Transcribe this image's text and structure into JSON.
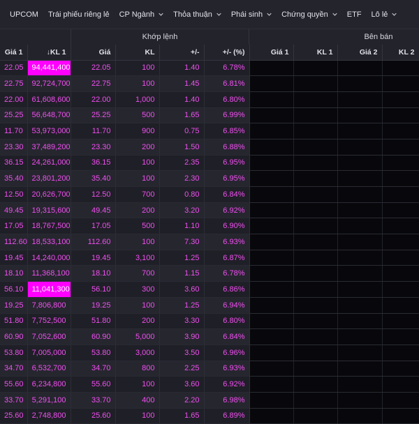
{
  "nav": [
    {
      "label": "UPCOM",
      "dropdown": false
    },
    {
      "label": "Trái phiếu riêng lẻ",
      "dropdown": false
    },
    {
      "label": "CP Ngành",
      "dropdown": true
    },
    {
      "label": "Thỏa thuận",
      "dropdown": true
    },
    {
      "label": "Phái sinh",
      "dropdown": true
    },
    {
      "label": "Chứng quyền",
      "dropdown": true
    },
    {
      "label": "ETF",
      "dropdown": false
    },
    {
      "label": "Lô lẻ",
      "dropdown": true
    }
  ],
  "groups": {
    "match": "Khớp lệnh",
    "sell": "Bên bán"
  },
  "columns": {
    "gia1": "Giá 1",
    "kl1_sort": "↓KL 1",
    "gia": "Giá",
    "kl": "KL",
    "change": "+/-",
    "pct": "+/- (%)",
    "sell_gia1": "Giá 1",
    "sell_kl1": "KL 1",
    "sell_gia2": "Giá 2",
    "sell_kl2": "KL 2"
  },
  "rows": [
    {
      "gia1": "22.05",
      "kl1": "94,441,400",
      "gia": "22.05",
      "kl": "100",
      "change": "1.40",
      "pct": "6.78%",
      "hl": true
    },
    {
      "gia1": "22.75",
      "kl1": "92,724,700",
      "gia": "22.75",
      "kl": "100",
      "change": "1.45",
      "pct": "6.81%"
    },
    {
      "gia1": "22.00",
      "kl1": "61,608,600",
      "gia": "22.00",
      "kl": "1,000",
      "change": "1.40",
      "pct": "6.80%"
    },
    {
      "gia1": "25.25",
      "kl1": "56,648,700",
      "gia": "25.25",
      "kl": "500",
      "change": "1.65",
      "pct": "6.99%"
    },
    {
      "gia1": "11.70",
      "kl1": "53,973,000",
      "gia": "11.70",
      "kl": "900",
      "change": "0.75",
      "pct": "6.85%"
    },
    {
      "gia1": "23.30",
      "kl1": "37,489,200",
      "gia": "23.30",
      "kl": "200",
      "change": "1.50",
      "pct": "6.88%"
    },
    {
      "gia1": "36.15",
      "kl1": "24,261,000",
      "gia": "36.15",
      "kl": "100",
      "change": "2.35",
      "pct": "6.95%"
    },
    {
      "gia1": "35.40",
      "kl1": "23,801,200",
      "gia": "35.40",
      "kl": "100",
      "change": "2.30",
      "pct": "6.95%"
    },
    {
      "gia1": "12.50",
      "kl1": "20,626,700",
      "gia": "12.50",
      "kl": "700",
      "change": "0.80",
      "pct": "6.84%"
    },
    {
      "gia1": "49.45",
      "kl1": "19,315,600",
      "gia": "49.45",
      "kl": "200",
      "change": "3.20",
      "pct": "6.92%"
    },
    {
      "gia1": "17.05",
      "kl1": "18,767,500",
      "gia": "17.05",
      "kl": "500",
      "change": "1.10",
      "pct": "6.90%"
    },
    {
      "gia1": "112.60",
      "kl1": "18,533,100",
      "gia": "112.60",
      "kl": "100",
      "change": "7.30",
      "pct": "6.93%"
    },
    {
      "gia1": "19.45",
      "kl1": "14,240,000",
      "gia": "19.45",
      "kl": "3,100",
      "change": "1.25",
      "pct": "6.87%"
    },
    {
      "gia1": "18.10",
      "kl1": "11,368,100",
      "gia": "18.10",
      "kl": "700",
      "change": "1.15",
      "pct": "6.78%"
    },
    {
      "gia1": "56.10",
      "kl1": "11,041,300",
      "gia": "56.10",
      "kl": "300",
      "change": "3.60",
      "pct": "6.86%",
      "hl": true
    },
    {
      "gia1": "19.25",
      "kl1": "7,806,800",
      "gia": "19.25",
      "kl": "100",
      "change": "1.25",
      "pct": "6.94%"
    },
    {
      "gia1": "51.80",
      "kl1": "7,752,500",
      "gia": "51.80",
      "kl": "200",
      "change": "3.30",
      "pct": "6.80%"
    },
    {
      "gia1": "60.90",
      "kl1": "7,052,600",
      "gia": "60.90",
      "kl": "5,000",
      "change": "3.90",
      "pct": "6.84%"
    },
    {
      "gia1": "53.80",
      "kl1": "7,005,000",
      "gia": "53.80",
      "kl": "3,000",
      "change": "3.50",
      "pct": "6.96%"
    },
    {
      "gia1": "34.70",
      "kl1": "6,532,700",
      "gia": "34.70",
      "kl": "800",
      "change": "2.25",
      "pct": "6.93%"
    },
    {
      "gia1": "55.60",
      "kl1": "6,234,800",
      "gia": "55.60",
      "kl": "100",
      "change": "3.60",
      "pct": "6.92%"
    },
    {
      "gia1": "33.70",
      "kl1": "5,291,100",
      "gia": "33.70",
      "kl": "400",
      "change": "2.20",
      "pct": "6.98%"
    },
    {
      "gia1": "25.60",
      "kl1": "2,748,800",
      "gia": "25.60",
      "kl": "100",
      "change": "1.65",
      "pct": "6.89%"
    }
  ],
  "colors": {
    "ceiling": "#f04ff0",
    "highlight": "#ff00ff",
    "background": "#1a1a22"
  }
}
